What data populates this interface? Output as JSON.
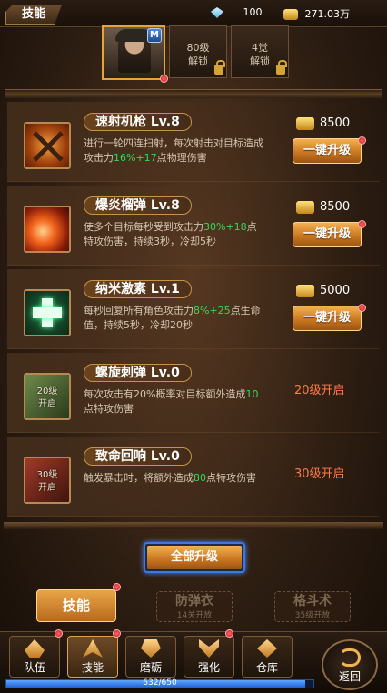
{
  "header": {
    "title": "技能",
    "gems": "100",
    "gold": "271.03万"
  },
  "hero": {
    "badge": "M",
    "slots": [
      {
        "label": "80级\n解锁"
      },
      {
        "label": "4觉\n解锁"
      }
    ]
  },
  "skills": [
    {
      "name": "速射机枪 Lv.8",
      "desc_parts": [
        "进行一轮四连扫射，每次射击对目标造成攻击力",
        "16%+17",
        "点物理伤害"
      ],
      "cost": "8500",
      "action": "一键升级",
      "icon": "machine-gun-icon",
      "locked": false
    },
    {
      "name": "爆炎榴弹 Lv.8",
      "desc_parts": [
        "使多个目标每秒受到攻击力",
        "30%+18",
        "点特攻伤害，持续3秒，冷却5秒"
      ],
      "cost": "8500",
      "action": "一键升级",
      "icon": "grenade-icon",
      "locked": false
    },
    {
      "name": "纳米激素 Lv.1",
      "desc_parts": [
        "每秒回复所有角色攻击力",
        "8%+25",
        "点生命值，持续5秒，冷却20秒"
      ],
      "cost": "5000",
      "action": "一键升级",
      "icon": "heal-cross-icon",
      "locked": false
    },
    {
      "name": "螺旋刺弹 Lv.0",
      "desc_parts": [
        "每次攻击有20%概率对目标额外造成",
        "10",
        "点特攻伤害"
      ],
      "lock_label": "20级\n开启",
      "unlock_text": "20级开启",
      "icon": "spiral-bullet-icon",
      "locked": true
    },
    {
      "name": "致命回响 Lv.0",
      "desc_parts": [
        "触发暴击时，将额外造成",
        "80",
        "点特攻伤害"
      ],
      "lock_label": "30级\n开启",
      "unlock_text": "30级开启",
      "icon": "fatal-echo-icon",
      "locked": true
    }
  ],
  "all_upgrade": "全部升级",
  "subtabs": {
    "main": "技能",
    "locked": [
      {
        "title": "防弹衣",
        "sub": "14关开放"
      },
      {
        "title": "格斗术",
        "sub": "35级开放"
      }
    ]
  },
  "nav": {
    "items": [
      {
        "label": "队伍",
        "icon": "team-icon"
      },
      {
        "label": "技能",
        "icon": "skill-icon"
      },
      {
        "label": "磨砺",
        "icon": "hone-icon"
      },
      {
        "label": "强化",
        "icon": "enhance-icon"
      },
      {
        "label": "仓库",
        "icon": "warehouse-icon"
      }
    ],
    "back": "返回"
  },
  "xp": {
    "text": "632/650",
    "progress": 0.972
  },
  "colors": {
    "accent": "#e6a23c",
    "green": "#35d85a",
    "locked_text": "#ff7a4a"
  }
}
